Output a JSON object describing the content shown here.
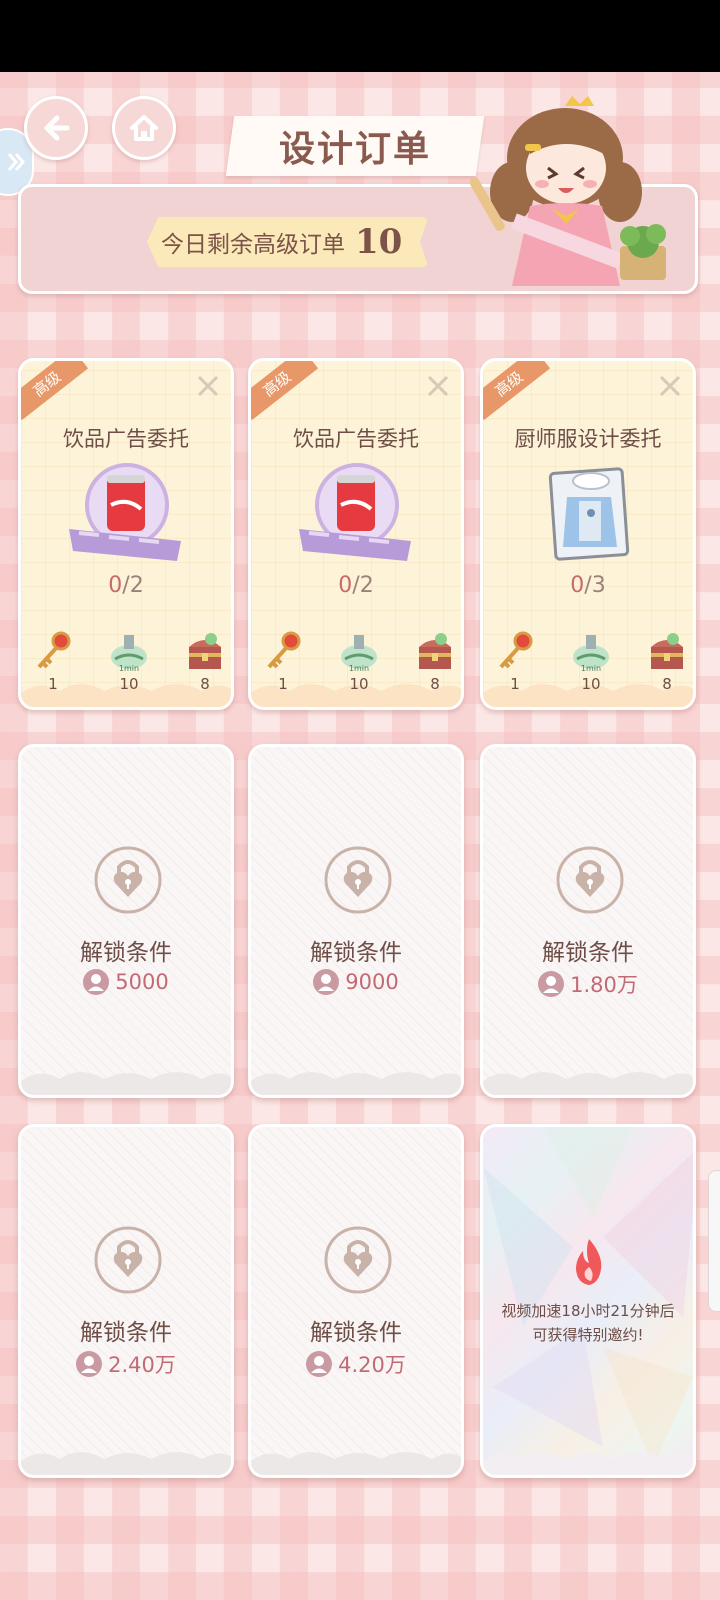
{
  "header": {
    "title": "设计订单",
    "remaining_label": "今日剩余高级订单",
    "remaining_count": "10"
  },
  "orders": [
    {
      "badge": "高级",
      "title": "饮品广告委托",
      "progress_current": "0",
      "progress_total": "/2",
      "item": "soda-can-icon",
      "rewards": [
        {
          "icon": "key-icon",
          "count": "1"
        },
        {
          "icon": "time-potion-icon",
          "count": "10"
        },
        {
          "icon": "treasure-chest-icon",
          "count": "8"
        }
      ]
    },
    {
      "badge": "高级",
      "title": "饮品广告委托",
      "progress_current": "0",
      "progress_total": "/2",
      "item": "soda-can-icon",
      "rewards": [
        {
          "icon": "key-icon",
          "count": "1"
        },
        {
          "icon": "time-potion-icon",
          "count": "10"
        },
        {
          "icon": "treasure-chest-icon",
          "count": "8"
        }
      ]
    },
    {
      "badge": "高级",
      "title": "厨师服设计委托",
      "progress_current": "0",
      "progress_total": "/3",
      "item": "chef-uniform-icon",
      "rewards": [
        {
          "icon": "key-icon",
          "count": "1"
        },
        {
          "icon": "time-potion-icon",
          "count": "10"
        },
        {
          "icon": "treasure-chest-icon",
          "count": "8"
        }
      ]
    }
  ],
  "locked_slots": [
    {
      "label": "解锁条件",
      "requirement": "5000"
    },
    {
      "label": "解锁条件",
      "requirement": "9000"
    },
    {
      "label": "解锁条件",
      "requirement": "1.80万"
    },
    {
      "label": "解锁条件",
      "requirement": "2.40万"
    },
    {
      "label": "解锁条件",
      "requirement": "4.20万"
    }
  ],
  "special_slot": {
    "line1": "视频加速18小时21分钟后",
    "line2": "可获得特别邀约!"
  },
  "potion_tag": "1min",
  "colors": {
    "ribbon": "#e89868",
    "requirement": "#c26a74",
    "accent_text": "#6e4e46"
  }
}
